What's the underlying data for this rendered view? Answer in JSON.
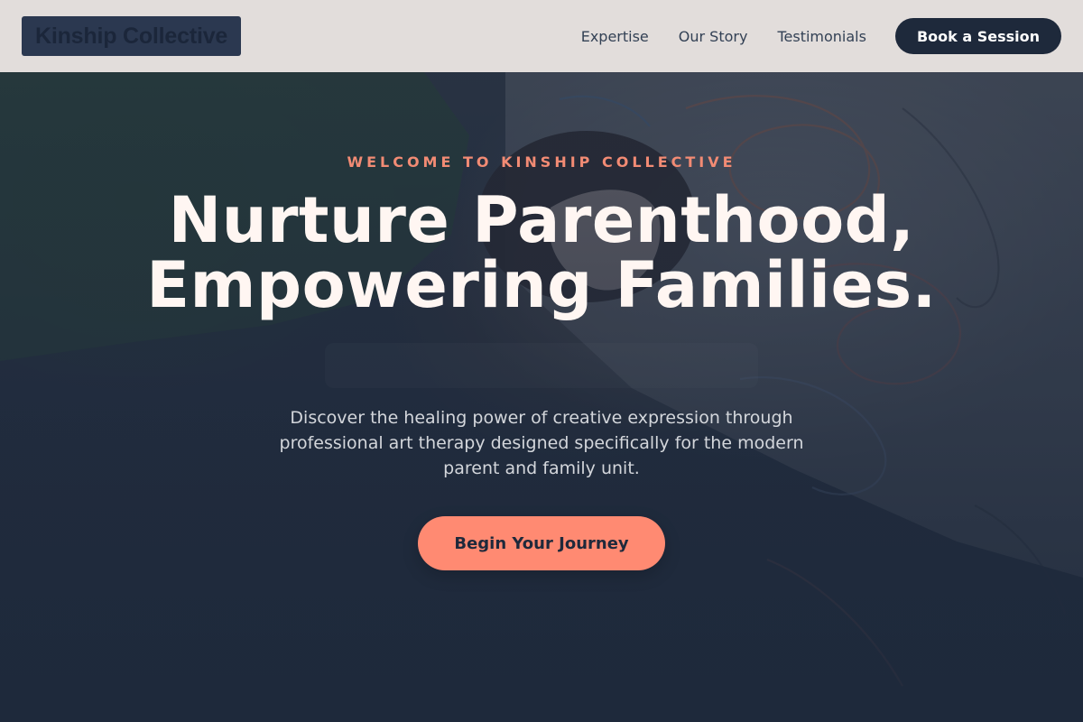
{
  "header": {
    "brand": "Kinship Collective",
    "nav": [
      {
        "label": "Expertise"
      },
      {
        "label": "Our Story"
      },
      {
        "label": "Testimonials"
      }
    ],
    "cta_label": "Book a Session"
  },
  "hero": {
    "eyebrow": "WELCOME TO KINSHIP COLLECTIVE",
    "headline": "Nurture Parenthood, Empowering Families.",
    "subtitle": "Discover the healing power of creative expression through professional art therapy designed specifically for the modern parent and family unit.",
    "cta_label": "Begin Your Journey",
    "background_image": "photo-parent-child-drawing"
  },
  "colors": {
    "accent": "#ff8a72",
    "eyebrow": "#f28b74",
    "dark": "#1e293b",
    "header_bg": "#eee8e4",
    "headline": "#fff6f2"
  }
}
